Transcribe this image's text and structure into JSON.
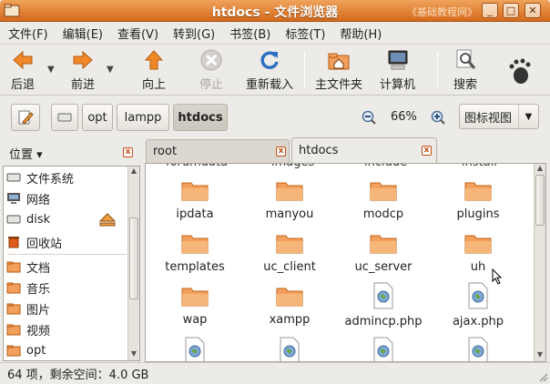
{
  "window": {
    "title": "htdocs - 文件浏览器",
    "watermark": "《基础教程网》",
    "min_glyph": "_",
    "max_glyph": "□",
    "close_glyph": "✕",
    "accent": "#d46a1c"
  },
  "menu": [
    "文件(F)",
    "编辑(E)",
    "查看(V)",
    "转到(G)",
    "书签(B)",
    "标签(T)",
    "帮助(H)"
  ],
  "toolbar": {
    "back": "后退",
    "forward": "前进",
    "up": "向上",
    "stop": "停止",
    "reload": "重新载入",
    "home": "主文件夹",
    "computer": "计算机",
    "search": "搜索"
  },
  "location": {
    "path": [
      "opt",
      "lampp",
      "htdocs"
    ],
    "zoom": "66%",
    "view": "图标视图"
  },
  "sidebar": {
    "selector": "位置",
    "items": [
      {
        "label": "文件系统",
        "icon": "drive-icon"
      },
      {
        "label": "网络",
        "icon": "network-icon"
      },
      {
        "label": "disk",
        "icon": "drive-icon"
      },
      {
        "label": "回收站",
        "icon": "trash-icon"
      },
      {
        "label": "文档",
        "icon": "folder-icon"
      },
      {
        "label": "音乐",
        "icon": "folder-icon"
      },
      {
        "label": "图片",
        "icon": "folder-icon"
      },
      {
        "label": "视频",
        "icon": "folder-icon"
      },
      {
        "label": "opt",
        "icon": "folder-icon"
      }
    ]
  },
  "tabs": [
    {
      "label": "root",
      "active": false
    },
    {
      "label": "htdocs",
      "active": true
    }
  ],
  "files_cut": [
    "forumdata",
    "images",
    "include",
    "install"
  ],
  "files": [
    {
      "name": "ipdata",
      "type": "folder"
    },
    {
      "name": "manyou",
      "type": "folder"
    },
    {
      "name": "modcp",
      "type": "folder"
    },
    {
      "name": "plugins",
      "type": "folder"
    },
    {
      "name": "templates",
      "type": "folder"
    },
    {
      "name": "uc_client",
      "type": "folder"
    },
    {
      "name": "uc_server",
      "type": "folder"
    },
    {
      "name": "uh",
      "type": "folder"
    },
    {
      "name": "wap",
      "type": "folder"
    },
    {
      "name": "xampp",
      "type": "folder"
    },
    {
      "name": "admincp.php",
      "type": "php"
    },
    {
      "name": "ajax.php",
      "type": "php"
    }
  ],
  "status": "64 项，剩余空间：4.0 GB"
}
